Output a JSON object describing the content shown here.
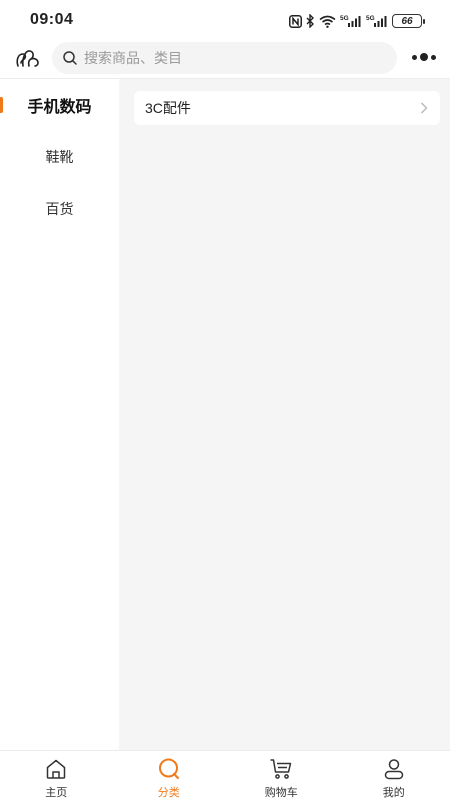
{
  "status_bar": {
    "time": "09:04",
    "battery": "66",
    "network": "5G"
  },
  "header": {
    "search_placeholder": "搜索商品、类目"
  },
  "sidebar": {
    "items": [
      {
        "label": "手机数码",
        "active": true
      },
      {
        "label": "鞋靴",
        "active": false
      },
      {
        "label": "百货",
        "active": false
      }
    ]
  },
  "content": {
    "subcategories": [
      {
        "label": "3C配件"
      }
    ]
  },
  "bottom_nav": {
    "items": [
      {
        "label": "主页",
        "icon": "home-icon",
        "active": false
      },
      {
        "label": "分类",
        "icon": "category-icon",
        "active": true
      },
      {
        "label": "购物车",
        "icon": "cart-icon",
        "active": false
      },
      {
        "label": "我的",
        "icon": "user-icon",
        "active": false
      }
    ]
  },
  "colors": {
    "accent": "#f07a1a",
    "content_background": "#f5f5f5"
  }
}
